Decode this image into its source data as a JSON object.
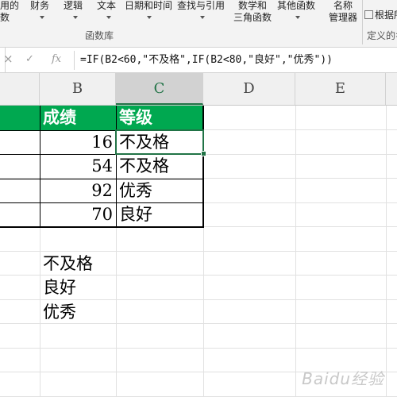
{
  "ribbon": {
    "buttons": [
      {
        "label_line1": "最近使用的",
        "label_line2": "函数",
        "visible_l1": "用的",
        "visible_l2": "数"
      },
      {
        "label_line1": "财务",
        "label_line2": ""
      },
      {
        "label_line1": "逻辑",
        "label_line2": ""
      },
      {
        "label_line1": "文本",
        "label_line2": ""
      },
      {
        "label_line1": "日期和时间",
        "label_line2": ""
      },
      {
        "label_line1": "查找与引用",
        "label_line2": ""
      },
      {
        "label_line1": "数学和",
        "label_line2": "三角函数"
      },
      {
        "label_line1": "其他函数",
        "label_line2": ""
      },
      {
        "label_line1": "名称",
        "label_line2": "管理器"
      }
    ],
    "define_name_label": "根据所",
    "function_library_label": "函数库",
    "defined_names_label": "定义的名"
  },
  "formula_bar": {
    "cancel_icon": "×",
    "enter_icon": "✓",
    "fx_icon": "fx",
    "formula": "=IF(B2<60,\"不及格\",IF(B2<80,\"良好\",\"优秀\"))"
  },
  "columns": [
    "B",
    "C",
    "D",
    "E"
  ],
  "active_column": "C",
  "table": {
    "headers": {
      "b": "成绩",
      "c": "等级"
    },
    "rows": [
      {
        "score": "16",
        "grade": "不及格"
      },
      {
        "score": "54",
        "grade": "不及格"
      },
      {
        "score": "92",
        "grade": "优秀"
      },
      {
        "score": "70",
        "grade": "良好"
      }
    ]
  },
  "notes": [
    "不及格",
    "良好",
    "优秀"
  ],
  "watermark": "Baidu经验",
  "colors": {
    "header_green": "#00a850",
    "excel_green": "#217346"
  }
}
